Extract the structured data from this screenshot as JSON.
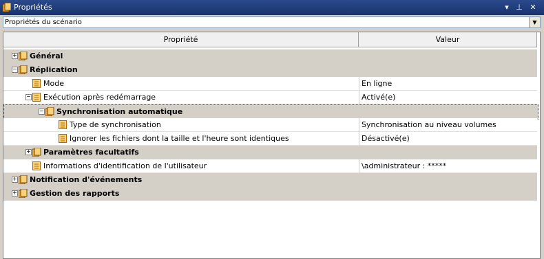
{
  "window": {
    "title": "Propriétés"
  },
  "dropdown": {
    "value": "Propriétés du scénario"
  },
  "columns": {
    "property": "Propriété",
    "value": "Valeur"
  },
  "rows": [
    {
      "label": "Général",
      "value": ""
    },
    {
      "label": "Réplication",
      "value": ""
    },
    {
      "label": "Mode",
      "value": "En ligne"
    },
    {
      "label": "Exécution après redémarrage",
      "value": "Activé(e)"
    },
    {
      "label": "Synchronisation automatique",
      "value": ""
    },
    {
      "label": "Type de synchronisation",
      "value": "Synchronisation au niveau volumes"
    },
    {
      "label": "Ignorer les fichiers dont la taille et l'heure sont identiques",
      "value": "Désactivé(e)"
    },
    {
      "label": "Paramètres facultatifs",
      "value": ""
    },
    {
      "label": "Informations d'identification de l'utilisateur",
      "value": "\\administrateur : *****"
    },
    {
      "label": "Notification d'événements",
      "value": ""
    },
    {
      "label": "Gestion des rapports",
      "value": ""
    }
  ]
}
